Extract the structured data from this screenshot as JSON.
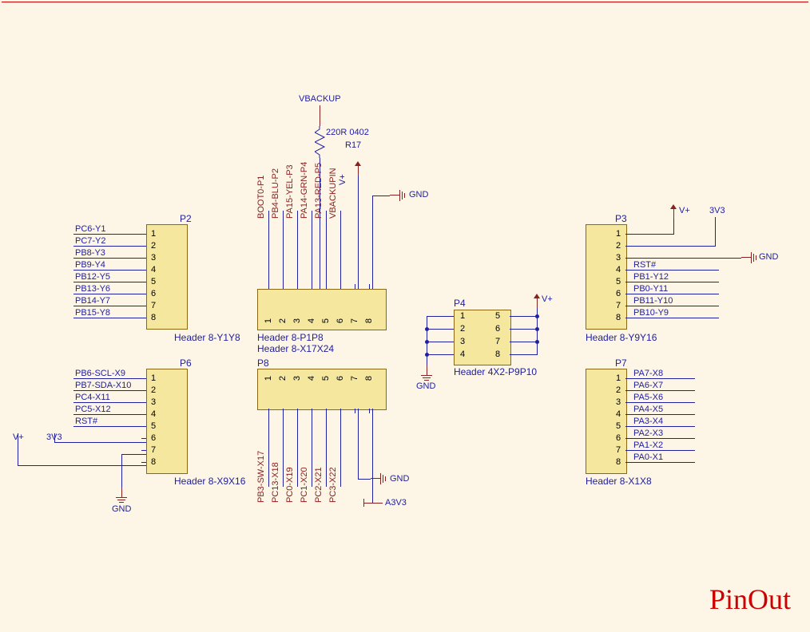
{
  "title": "PinOut",
  "components": {
    "P2": {
      "ref": "P2",
      "type": "Header 8-Y1Y8",
      "pins": [
        "1",
        "2",
        "3",
        "4",
        "5",
        "6",
        "7",
        "8"
      ],
      "nets": [
        "PC6-Y1",
        "PC7-Y2",
        "PB8-Y3",
        "PB9-Y4",
        "PB12-Y5",
        "PB13-Y6",
        "PB14-Y7",
        "PB15-Y8"
      ]
    },
    "P6": {
      "ref": "P6",
      "type": "Header 8-X9X16",
      "pins": [
        "1",
        "2",
        "3",
        "4",
        "5",
        "6",
        "7",
        "8"
      ],
      "nets": [
        "PB6-SCL-X9",
        "PB7-SDA-X10",
        "PC4-X11",
        "PC5-X12",
        "RST#",
        "",
        "",
        ""
      ],
      "extra": {
        "pin6": "3V3",
        "pin7": "GND",
        "pin8": "V+"
      }
    },
    "P5": {
      "ref": "P5",
      "type": "Header 8-P1P8",
      "type2": "Header 8-X17X24",
      "pins": [
        "1",
        "2",
        "3",
        "4",
        "5",
        "6",
        "7",
        "8"
      ],
      "nets": [
        "BOOT0-P1",
        "PB4-BLU-P2",
        "PA15-YEL-P3",
        "PA14-GRN-P4",
        "PA13-RED-P5",
        "VBACKUPIN",
        "",
        ""
      ],
      "extra": {
        "pin7": "V+",
        "pin8": "GND"
      }
    },
    "P8": {
      "ref": "P8",
      "type": "",
      "pins": [
        "1",
        "2",
        "3",
        "4",
        "5",
        "6",
        "7",
        "8"
      ],
      "nets": [
        "PB3-SW-X17",
        "PC13-X18",
        "PC0-X19",
        "PC1-X20",
        "PC2-X21",
        "PC3-X22",
        "",
        ""
      ],
      "extra": {
        "pin7": "GND",
        "pin8": "A3V3"
      }
    },
    "P4": {
      "ref": "P4",
      "type": "Header 4X2-P9P10",
      "left_pins": [
        "1",
        "2",
        "3",
        "4"
      ],
      "right_pins": [
        "5",
        "6",
        "7",
        "8"
      ],
      "left_net": "GND",
      "right_net": "V+"
    },
    "P3": {
      "ref": "P3",
      "type": "Header 8-Y9Y16",
      "pins": [
        "1",
        "2",
        "3",
        "4",
        "5",
        "6",
        "7",
        "8"
      ],
      "nets": [
        "",
        "",
        "",
        "RST#",
        "PB1-Y12",
        "PB0-Y11",
        "PB11-Y10",
        "PB10-Y9"
      ],
      "extra": {
        "pin1": "V+",
        "pin2": "3V3",
        "pin3": "GND"
      }
    },
    "P7": {
      "ref": "P7",
      "type": "Header 8-X1X8",
      "pins": [
        "1",
        "2",
        "3",
        "4",
        "5",
        "6",
        "7",
        "8"
      ],
      "nets": [
        "PA7-X8",
        "PA6-X7",
        "PA5-X6",
        "PA4-X5",
        "PA3-X4",
        "PA2-X3",
        "PA1-X2",
        "PA0-X1"
      ]
    },
    "R17": {
      "ref": "R17",
      "value": "220R 0402"
    }
  },
  "power": {
    "vbackup": "VBACKUP",
    "vplus": "V+",
    "gnd": "GND",
    "v3v3": "3V3",
    "a3v3": "A3V3"
  }
}
